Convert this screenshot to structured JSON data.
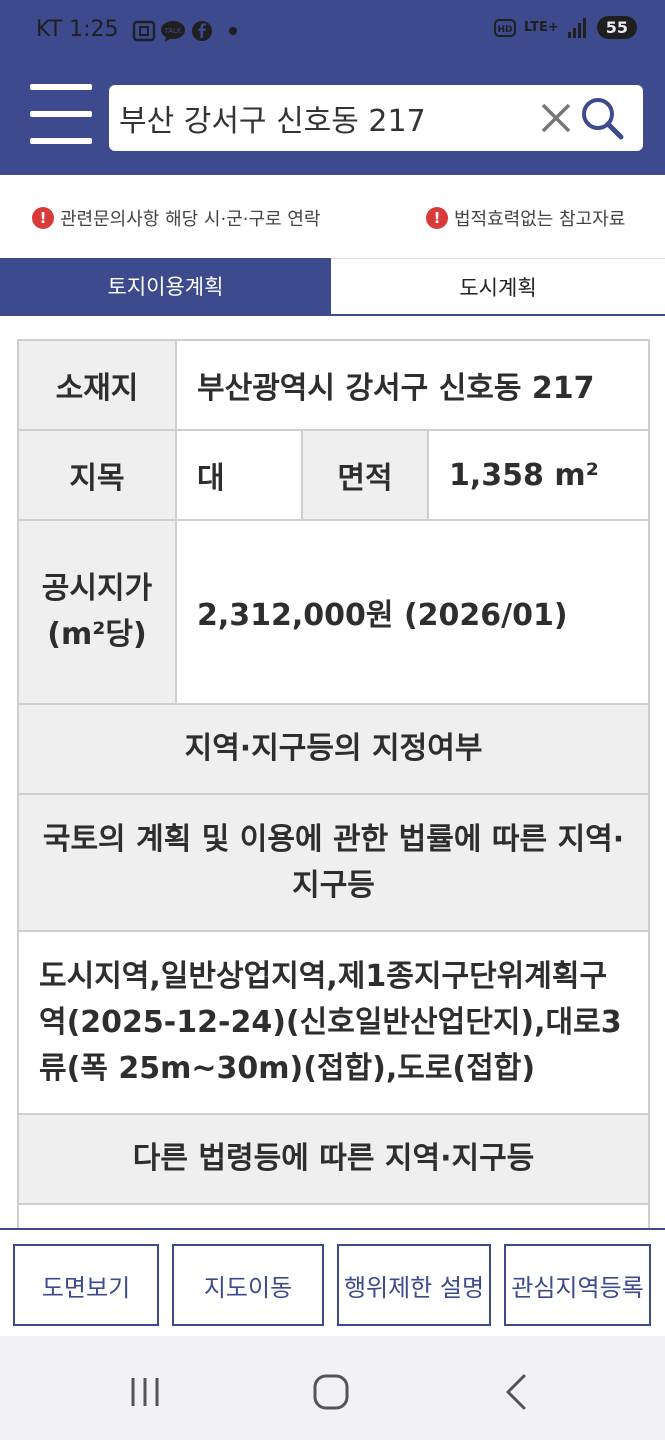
{
  "status_bar": {
    "carrier_time": "KT 1:25",
    "network": "LTE+",
    "hd_label": "HD",
    "battery": "55",
    "icons": [
      "screenshot-icon",
      "talk-icon",
      "facebook-icon",
      "dot-icon",
      "hd-voice-icon",
      "signal-icon"
    ]
  },
  "header": {
    "search_value": "부산 강서구 신호동 217"
  },
  "notices": [
    {
      "text": "관련문의사항 해당 시·군·구로 연락"
    },
    {
      "text": "법적효력없는 참고자료"
    }
  ],
  "tabs": [
    {
      "label": "토지이용계획",
      "active": true
    },
    {
      "label": "도시계획",
      "active": false
    }
  ],
  "info": {
    "location_label": "소재지",
    "location_value": "부산광역시 강서구 신호동 217",
    "land_category_label": "지목",
    "land_category_value": "대",
    "area_label": "면적",
    "area_value": "1,358 m²",
    "price_label": "공시지가(m²당)",
    "price_value": "2,312,000원 (2026/01)",
    "zone_heading": "지역·지구등의 지정여부",
    "law_heading": "국토의 계획 및 이용에 관한 법률에 따른 지역·지구등",
    "law_value": "도시지역,일반상업지역,제1종지구단위계획구역(2025-12-24)(신호일반산업단지),대로3류(폭 25m~30m)(접합),도로(접합)",
    "other_heading": "다른 법령등에 따른 지역·지구등"
  },
  "bottom_buttons": [
    {
      "label": "도면보기"
    },
    {
      "label": "지도이동"
    },
    {
      "label": "행위제한 설명"
    },
    {
      "label": "관심지역등록"
    }
  ],
  "colors": {
    "brand": "#3d4a8e",
    "alert": "#d93b3b",
    "label_bg": "#efefef"
  }
}
